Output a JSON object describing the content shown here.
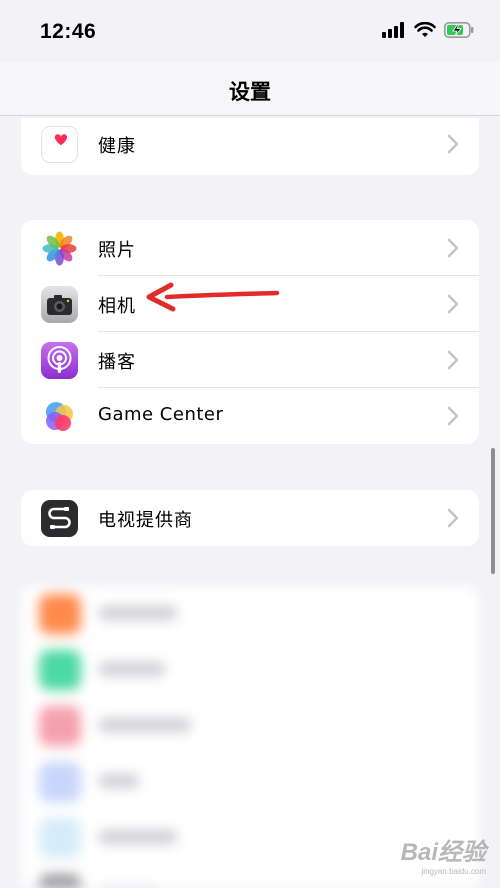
{
  "status": {
    "time": "12:46"
  },
  "nav": {
    "title": "设置"
  },
  "groups": [
    {
      "rows": [
        {
          "label": "健康",
          "icon": "health-icon"
        }
      ]
    },
    {
      "rows": [
        {
          "label": "照片",
          "icon": "photos-icon"
        },
        {
          "label": "相机",
          "icon": "camera-icon"
        },
        {
          "label": "播客",
          "icon": "podcasts-icon"
        },
        {
          "label": "Game Center",
          "icon": "game-center-icon"
        }
      ]
    },
    {
      "rows": [
        {
          "label": "电视提供商",
          "icon": "tv-provider-icon"
        }
      ]
    }
  ],
  "colors": {
    "background": "#f2f2f7",
    "annotation_arrow": "#e32b2b",
    "health": "#ff2d55",
    "podcasts": "#9b3fd6",
    "tv_provider": "#2c2c2e"
  },
  "watermark": {
    "text": "Bai经验",
    "sub": "jingyan.baidu.com"
  }
}
